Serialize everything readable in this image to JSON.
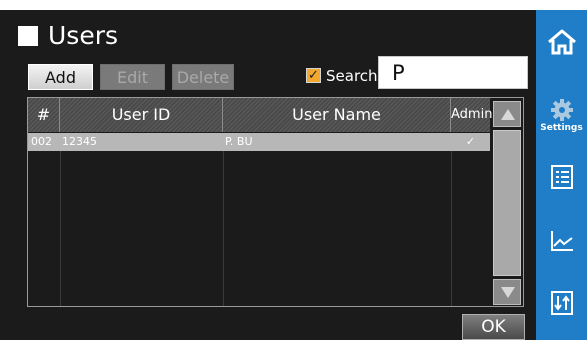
{
  "header": {
    "title": "Users"
  },
  "toolbar": {
    "add_label": "Add",
    "edit_label": "Edit",
    "delete_label": "Delete"
  },
  "search": {
    "label": "Search",
    "value": "P",
    "checked": true
  },
  "table": {
    "columns": [
      "#",
      "User ID",
      "User Name",
      "Admin"
    ],
    "rows": [
      {
        "num": "002",
        "user_id": "12345",
        "user_name": "P. BU",
        "admin": "✓"
      }
    ]
  },
  "footer": {
    "ok_label": "OK"
  },
  "sidebar": {
    "items": [
      {
        "icon": "home-icon"
      },
      {
        "icon": "gear-icon",
        "label": "Settings"
      },
      {
        "icon": "list-icon"
      },
      {
        "icon": "line-chart-icon"
      },
      {
        "icon": "transfer-icon"
      }
    ]
  },
  "colors": {
    "sidebar": "#1f7ec7",
    "checkbox": "#f2a82c",
    "selected_row": "#b7b7b7"
  }
}
